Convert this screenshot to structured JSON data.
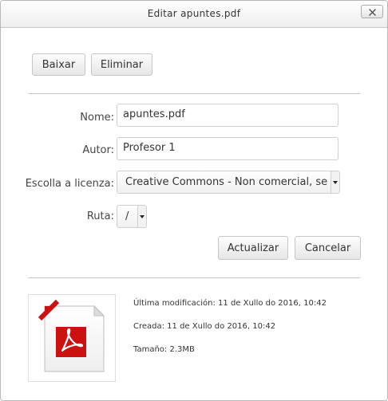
{
  "dialog": {
    "title": "Editar apuntes.pdf",
    "close_icon": "close-icon"
  },
  "toolbar": {
    "download_label": "Baixar",
    "delete_label": "Eliminar"
  },
  "form": {
    "name": {
      "label": "Nome:",
      "value": "apuntes.pdf"
    },
    "author": {
      "label": "Autor:",
      "value": "Profesor 1"
    },
    "license": {
      "label": "Escolla a licenza:",
      "value": "Creative Commons - Non comercial, se"
    },
    "path": {
      "label": "Ruta:",
      "value": "/"
    },
    "update_label": "Actualizar",
    "cancel_label": "Cancelar"
  },
  "file_info": {
    "icon": "pdf-file-icon",
    "modified": "Última modificación: 11 de Xullo do 2016, 10:42",
    "created": "Creada: 11 de Xullo do 2016, 10:42",
    "size": "Tamaño: 2.3MB"
  },
  "colors": {
    "pdf_red": "#cc1111",
    "button_border": "#c6c6c6",
    "divider": "#c9c9c9"
  }
}
